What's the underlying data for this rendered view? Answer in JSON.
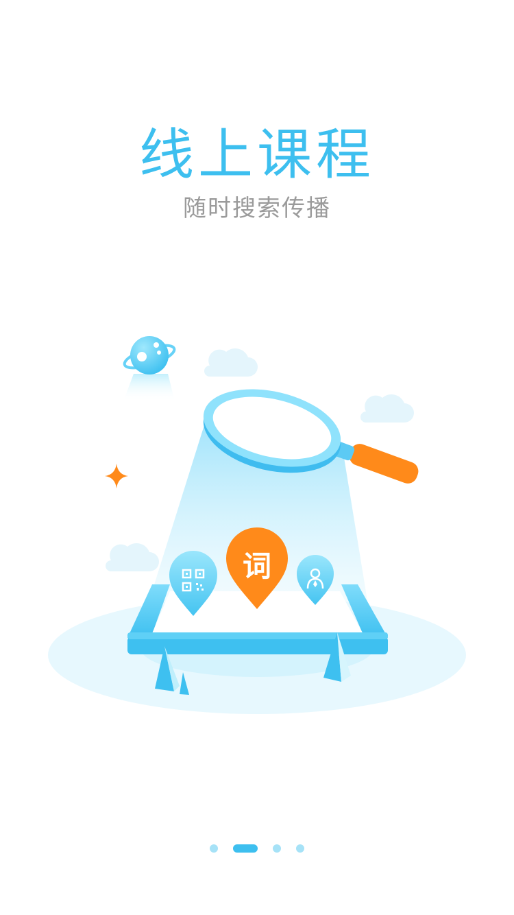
{
  "onboarding": {
    "title": "线上课程",
    "subtitle": "随时搜索传播",
    "marker_center_text": "词"
  },
  "colors": {
    "title": "#3dbfef",
    "subtitle": "#9a9a9a",
    "accent_orange": "#ff8a1a",
    "light_blue": "#9fe3fb",
    "pale_blue": "#e7f8fe",
    "dot_inactive": "#a6e2f7",
    "dot_active": "#3dbfef"
  },
  "pager": {
    "total": 4,
    "active_index": 1
  },
  "icons": [
    "planet-icon",
    "cloud-icon",
    "sparkle-icon",
    "magnifier-icon",
    "qr-code-icon",
    "word-marker-icon",
    "user-icon",
    "phone-frame"
  ]
}
